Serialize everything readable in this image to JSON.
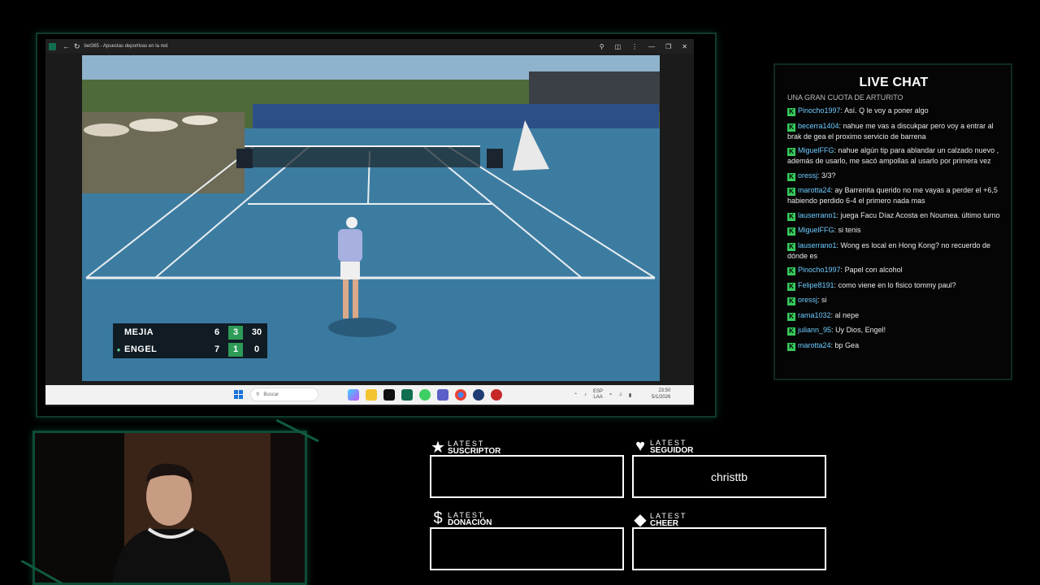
{
  "browser": {
    "window_title": "bet365 - Apuestas deportivas en la red"
  },
  "scoreboard": {
    "players": [
      {
        "name": "MEJIA",
        "set1": "6",
        "set2": "3",
        "points": "30",
        "serving": false
      },
      {
        "name": "ENGEL",
        "set1": "7",
        "set2": "1",
        "points": "0",
        "serving": true
      }
    ]
  },
  "taskbar": {
    "search_placeholder": "Buscar",
    "lang": "ESP",
    "lang_sub": "LAA",
    "time": "23:50",
    "date": "5/1/2026"
  },
  "chat": {
    "title": "LIVE CHAT",
    "cut_line": "UNA GRAN CUOTA DE ARTURITO",
    "messages": [
      {
        "user": "Pinocho1997",
        "text": "Así. Q le voy a poner algo"
      },
      {
        "user": "becerra1404",
        "text": "nahue me vas a discukpar pero voy a entrar al brak de gea el proximo servicio de barrena"
      },
      {
        "user": "MiguelFFG",
        "text": "nahue algún tip para ablandar un calzado nuevo , además de usarlo, me sacó ampollas al usarlo por primera vez"
      },
      {
        "user": "oressj",
        "text": "3/3?"
      },
      {
        "user": "marotta24",
        "text": "ay Barrenita querido no me vayas a perder el +6,5 habiendo perdido 6-4 el primero nada mas"
      },
      {
        "user": "lauserrano1",
        "text": "juega Facu Díaz Acosta en Noumea. último turno"
      },
      {
        "user": "MiguelFFG",
        "text": "si tenis"
      },
      {
        "user": "lauserrano1",
        "text": "Wong es local en Hong Kong? no recuerdo de dónde es"
      },
      {
        "user": "Pinocho1997",
        "text": "Papel con alcohol"
      },
      {
        "user": "Felipe8191",
        "text": "como viene en lo fisico tommy paul?"
      },
      {
        "user": "oressj",
        "text": "si"
      },
      {
        "user": "rama1032",
        "text": "al nepe"
      },
      {
        "user": "juliann_95",
        "text": "Uy Dios, Engel!"
      },
      {
        "user": "marotta24",
        "text": "bp Gea"
      }
    ]
  },
  "widgets": {
    "subscriber": {
      "l1": "LATEST",
      "l2": "SUSCRIPTOR",
      "value": ""
    },
    "follower": {
      "l1": "LATEST",
      "l2": "SEGUIDOR",
      "value": "christtb"
    },
    "donation": {
      "l1": "LATEST",
      "l2": "DONACIÓN",
      "value": ""
    },
    "cheer": {
      "l1": "LATEST",
      "l2": "CHEER",
      "value": ""
    }
  },
  "colors": {
    "accent_green": "#36c95b",
    "frame_green": "#0e4c37",
    "court_blue": "#3f7fa3",
    "username_blue": "#6ecbff"
  }
}
